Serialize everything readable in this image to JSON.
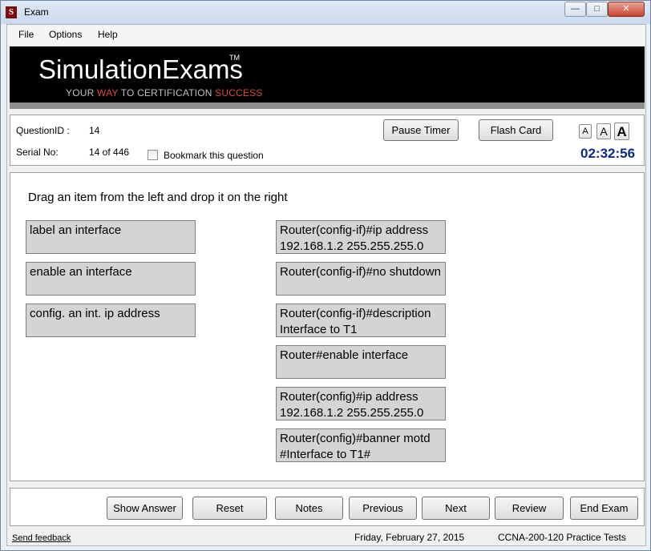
{
  "window": {
    "title": "Exam",
    "app_icon": "S"
  },
  "menu": [
    {
      "label": "File"
    },
    {
      "label": "Options"
    },
    {
      "label": "Help"
    }
  ],
  "banner": {
    "logo": "SimulationExams",
    "tm": "TM",
    "tagline_1": "YOUR ",
    "tagline_2": "WAY",
    "tagline_3": " TO CERTIFICATION ",
    "tagline_4": "SUCCESS",
    "accent_color": "#d94b3a"
  },
  "info": {
    "question_id_label": "QuestionID :",
    "question_id_value": "14",
    "serial_label": "Serial No:",
    "serial_value": "14 of 446",
    "bookmark_label": "Bookmark this question",
    "pause_timer": "Pause Timer",
    "flash_card": "Flash Card",
    "font_small": "A",
    "font_medium": "A",
    "font_large": "A",
    "timer": "02:32:56",
    "timer_color": "#0a2a8c"
  },
  "question": {
    "instruction": "Drag an item from the left and drop it on the right",
    "left_items": [
      "label an interface",
      "enable an interface",
      "config. an int. ip address"
    ],
    "right_items": [
      "Router(config-if)#ip address 192.168.1.2 255.255.255.0",
      "Router(config-if)#no shutdown",
      "Router(config-if)#description Interface to T1",
      "Router#enable interface",
      "Router(config)#ip address 192.168.1.2 255.255.255.0",
      "Router(config)#banner motd #Interface to T1#"
    ]
  },
  "buttons": {
    "show_answer": "Show Answer",
    "reset": "Reset",
    "notes": "Notes",
    "previous": "Previous",
    "next": "Next",
    "review": "Review",
    "end_exam": "End Exam"
  },
  "status": {
    "feedback": "Send feedback",
    "date": "Friday, February 27, 2015",
    "product": "CCNA-200-120 Practice Tests"
  }
}
